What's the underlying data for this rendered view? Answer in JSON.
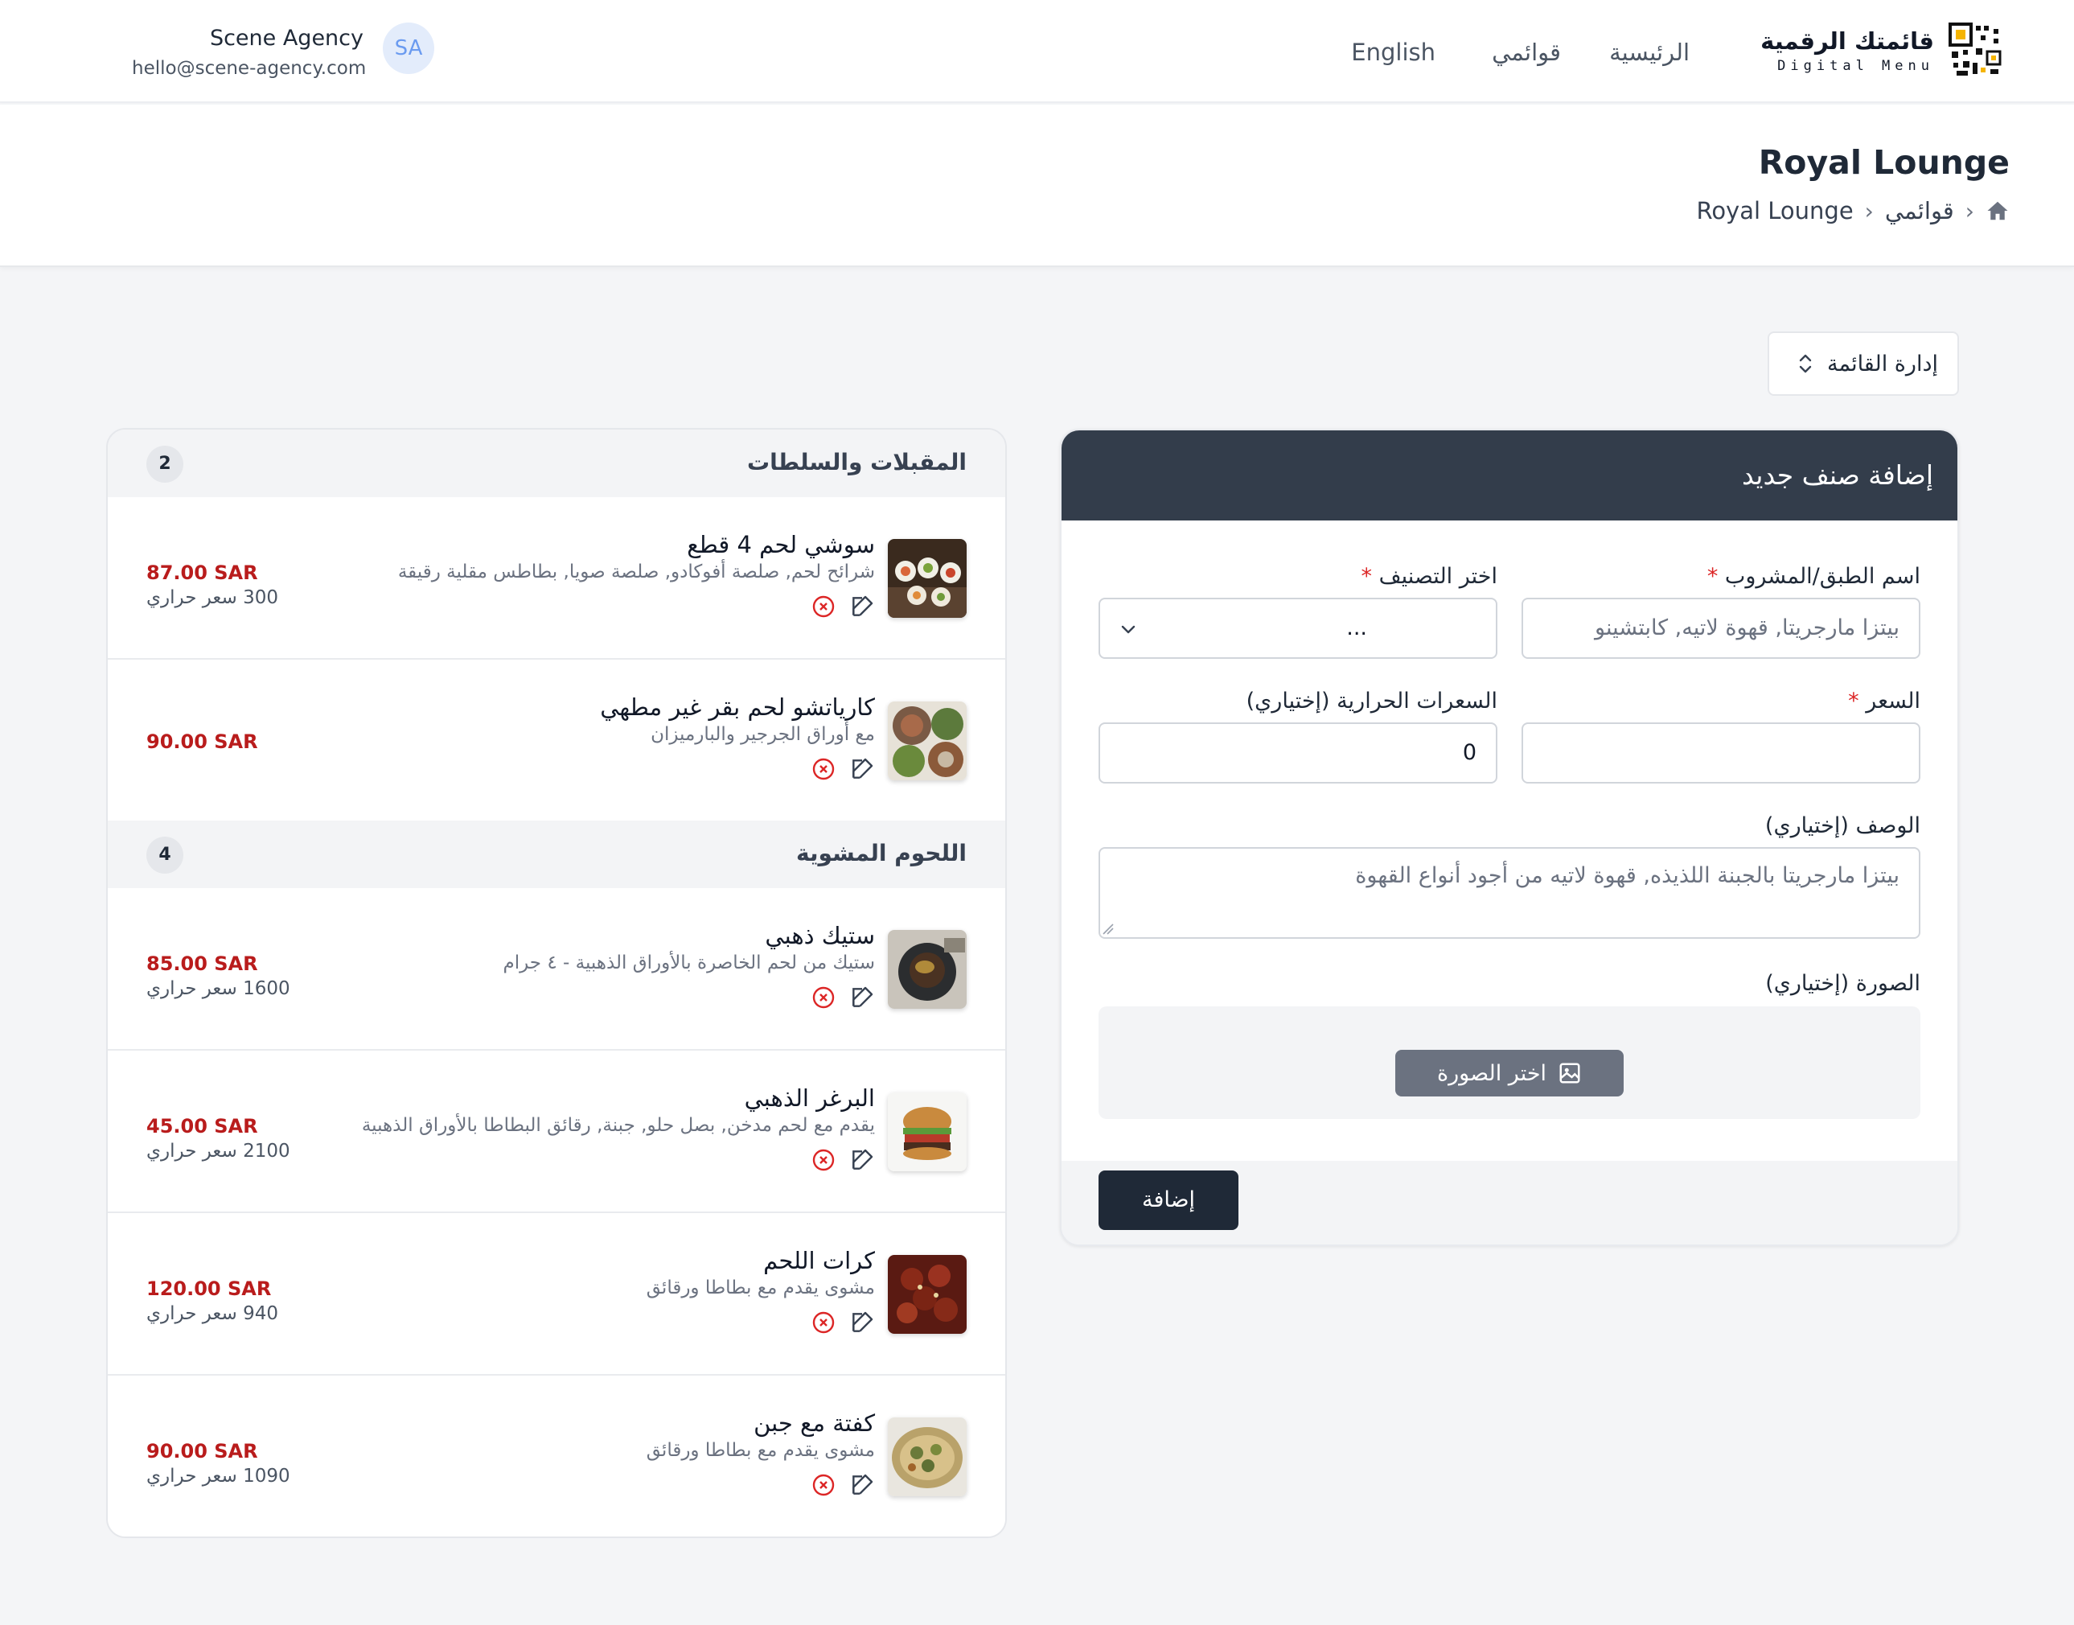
{
  "nav": {
    "brand_ar": "قائمتك الرقمية",
    "brand_en": "Digital Menu",
    "links": [
      "الرئيسية",
      "قوائمي",
      "English"
    ],
    "user_name": "Scene Agency",
    "user_email": "hello@scene-agency.com",
    "avatar_initials": "SA"
  },
  "header": {
    "title": "Royal Lounge",
    "breadcrumb": [
      "قوائمي",
      "Royal Lounge"
    ]
  },
  "manage_button": "إدارة القائمة",
  "form": {
    "title": "إضافة صنف جديد",
    "name_label": "اسم الطبق/المشروب",
    "name_placeholder": "بيتزا مارجريتا, قهوة لاتيه, كابتشينو",
    "category_label": "اختر التصنيف",
    "category_value": "...",
    "required_mark": "*",
    "price_label": "السعر",
    "price_value": "",
    "calories_label": "السعرات الحرارية (إختياري)",
    "calories_value": "0",
    "description_label": "الوصف (إختياري)",
    "description_placeholder": "بيتزا مارجريتا بالجبنة اللذيذه, قهوة لاتيه من أجود أنواع القهوة",
    "image_label": "الصورة (إختياري)",
    "image_button": "اختر الصورة",
    "submit": "إضافة"
  },
  "categories": [
    {
      "name": "المقبلات والسلطات",
      "count": "2",
      "items": [
        {
          "name": "سوشي لحم 4 قطع",
          "description": "شرائح لحم, صلصة أفوكادو, صلصة صويا, بطاطس مقلية رقيقة",
          "price": "87.00 SAR",
          "calories": "300 سعر حراري",
          "image": "sushi-image"
        },
        {
          "name": "كارياتشو لحم بقر غير مطهي",
          "description": "مع أوراق الجرجير والبارميزان",
          "price": "90.00 SAR",
          "calories": "",
          "image": "carpaccio-image"
        }
      ]
    },
    {
      "name": "اللحوم المشوية",
      "count": "4",
      "items": [
        {
          "name": "ستيك ذهبي",
          "description": "ستيك من لحم الخاصرة بالأوراق الذهبية - ٤ جرام",
          "price": "85.00 SAR",
          "calories": "1600 سعر حراري",
          "image": "steak-image"
        },
        {
          "name": "البرغر الذهبي",
          "description": "يقدم مع لحم مدخن, بصل حلو, جبنة, رقائق البطاطا بالأوراق الذهبية",
          "price": "45.00 SAR",
          "calories": "2100 سعر حراري",
          "image": "burger-image"
        },
        {
          "name": "كرات اللحم",
          "description": "مشوى يقدم مع بطاطا ورقائق",
          "price": "120.00 SAR",
          "calories": "940 سعر حراري",
          "image": "meatballs-image"
        },
        {
          "name": "كفتة مع جبن",
          "description": "مشوى يقدم مع بطاطا ورقائق",
          "price": "90.00 SAR",
          "calories": "1090 سعر حراري",
          "image": "kofta-image"
        }
      ]
    }
  ],
  "colors": {
    "form_header": "#333d4b",
    "price": "#b91c1c",
    "submit_button": "#1f2937",
    "required": "#dc2626"
  }
}
